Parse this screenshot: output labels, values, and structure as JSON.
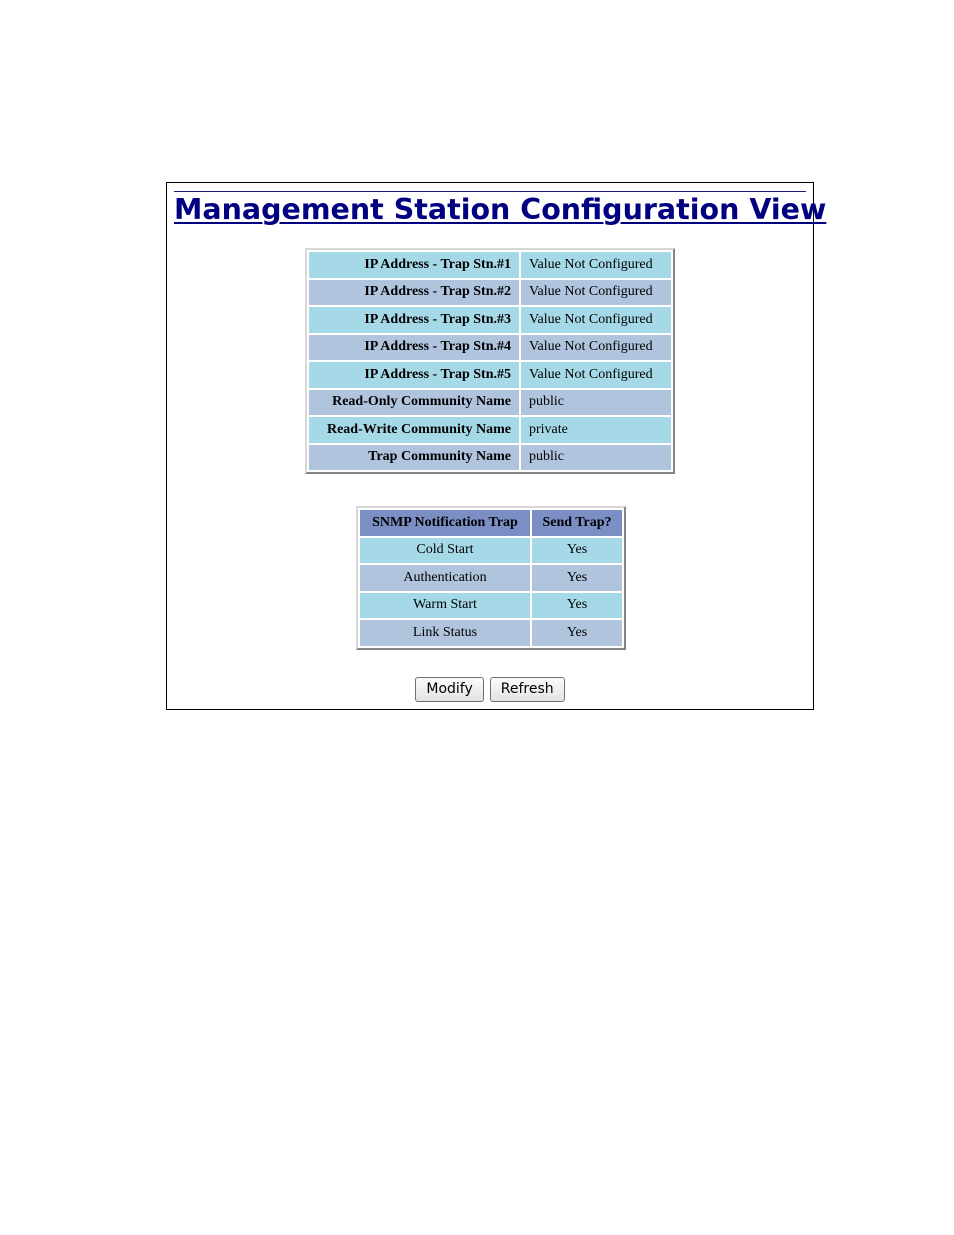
{
  "page": {
    "title": "Management Station Configuration View"
  },
  "config": {
    "rows": [
      {
        "label": "IP Address - Trap Stn.#1",
        "value": "Value Not Configured"
      },
      {
        "label": "IP Address - Trap Stn.#2",
        "value": "Value Not Configured"
      },
      {
        "label": "IP Address - Trap Stn.#3",
        "value": "Value Not Configured"
      },
      {
        "label": "IP Address - Trap Stn.#4",
        "value": "Value Not Configured"
      },
      {
        "label": "IP Address - Trap Stn.#5",
        "value": "Value Not Configured"
      },
      {
        "label": "Read-Only Community Name",
        "value": "public"
      },
      {
        "label": "Read-Write Community Name",
        "value": "private"
      },
      {
        "label": "Trap Community Name",
        "value": "public"
      }
    ]
  },
  "traps": {
    "headers": [
      "SNMP Notification Trap",
      "Send Trap?"
    ],
    "rows": [
      {
        "event": "Cold Start",
        "send": "Yes"
      },
      {
        "event": "Authentication",
        "send": "Yes"
      },
      {
        "event": "Warm Start",
        "send": "Yes"
      },
      {
        "event": "Link Status",
        "send": "Yes"
      }
    ]
  },
  "buttons": {
    "modify": "Modify",
    "refresh": "Refresh"
  },
  "colors": {
    "title": "#000080",
    "row_light": "#a6d9e8",
    "row_dark": "#b0c4de",
    "header": "#7b8fc4"
  }
}
